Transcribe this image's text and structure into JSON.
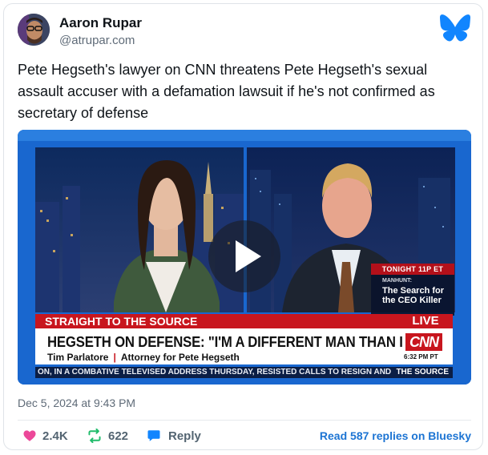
{
  "post": {
    "author_name": "Aaron Rupar",
    "handle": "@atrupar.com",
    "text": "Pete Hegseth's lawyer on CNN threatens Pete Hegseth's sexual assault accuser with a defamation lawsuit if he's not confirmed as secretary of defense",
    "timestamp": "Dec 5, 2024 at 9:43 PM"
  },
  "video": {
    "promo_tonight": "TONIGHT 11P ET",
    "promo_manhunt": "MANHUNT:",
    "promo_title": "The Search for the CEO Killer",
    "segment": "STRAIGHT TO THE SOURCE",
    "live": "LIVE",
    "headline": "HEGSETH ON DEFENSE: \"I'M A DIFFERENT MAN THAN I WAS\"",
    "guest_name": "Tim Parlatore",
    "separator": "|",
    "guest_title": "Attorney for Pete Hegseth",
    "network": "CNN",
    "clock": "6:32 PM PT",
    "ticker": "ON, IN A COMBATIVE TELEVISED ADDRESS THURSDAY, RESISTED CALLS TO RESIGN AND",
    "ticker_tag": "THE SOURCE"
  },
  "actions": {
    "likes": "2.4K",
    "reposts": "622",
    "reply_label": "Reply",
    "read_more": "Read 587 replies on Bluesky"
  },
  "icons": {
    "brand": "butterfly-icon",
    "like": "heart-icon",
    "repost": "repost-icon",
    "reply": "speech-bubble-icon",
    "play": "play-icon"
  },
  "colors": {
    "bluesky_blue": "#1185fe",
    "like_pink": "#ec4899",
    "repost_green": "#20bc6b",
    "cnn_red": "#c8161e",
    "link_blue": "#1c74d3"
  }
}
